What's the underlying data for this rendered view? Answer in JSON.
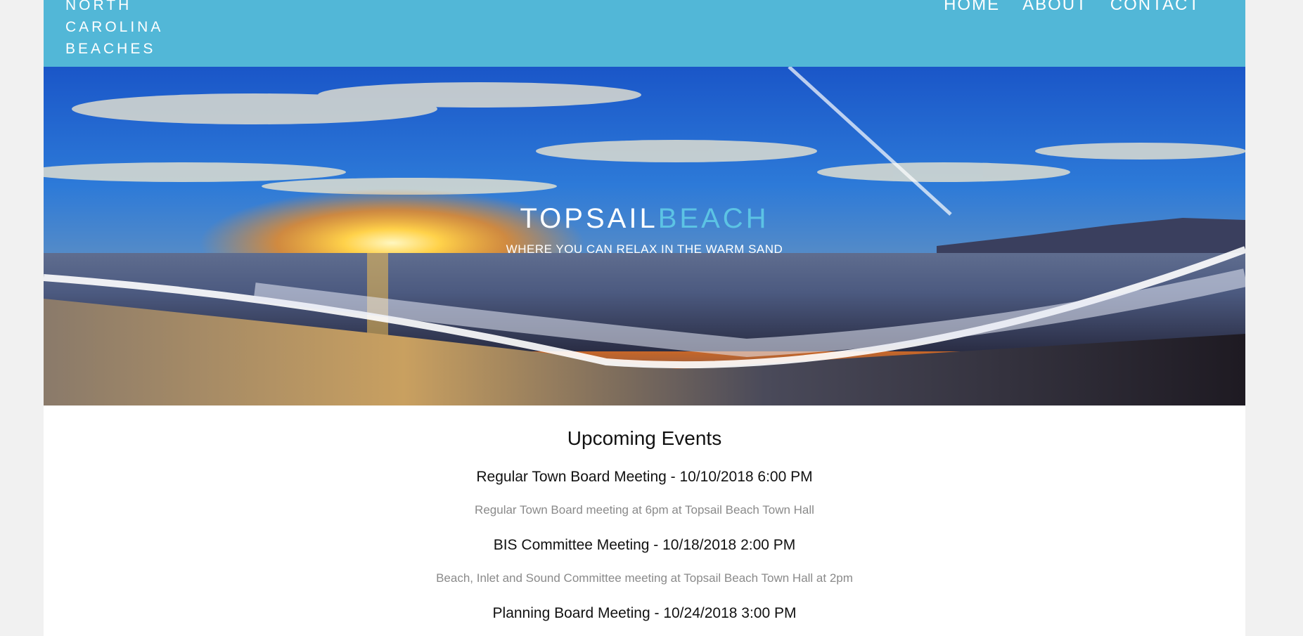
{
  "header": {
    "logo_lines": [
      "NORTH",
      "CAROLINA",
      "BEACHES"
    ],
    "nav": [
      {
        "label": "HOME"
      },
      {
        "label": "ABOUT"
      },
      {
        "label": "CONTACT"
      }
    ],
    "color": "#52b7d7"
  },
  "hero": {
    "title_part1": "TOPSAIL",
    "title_part2": "BEACH",
    "subtitle": "WHERE YOU CAN RELAX IN THE WARM SAND",
    "accent_color": "#5cc3e4"
  },
  "events": {
    "heading": "Upcoming Events",
    "items": [
      {
        "title": "Regular Town Board Meeting - 10/10/2018 6:00 PM",
        "description": "Regular Town Board meeting at 6pm at Topsail Beach Town Hall"
      },
      {
        "title": "BIS Committee Meeting - 10/18/2018 2:00 PM",
        "description": "Beach, Inlet and Sound Committee meeting at Topsail Beach Town Hall at 2pm"
      },
      {
        "title": "Planning Board Meeting - 10/24/2018 3:00 PM",
        "description": ""
      }
    ]
  }
}
